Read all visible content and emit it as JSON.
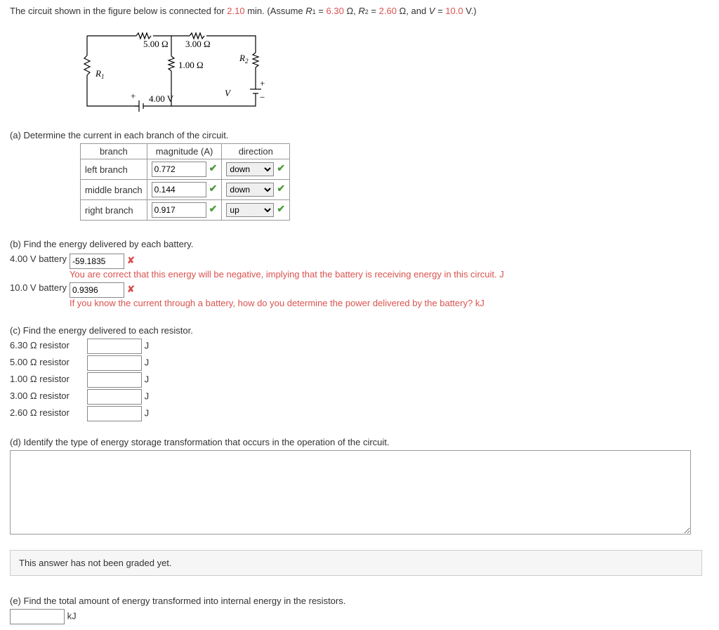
{
  "intro": {
    "prefix": "The circuit shown in the figure below is connected for ",
    "time": "2.10",
    "mid1": " min. (Assume ",
    "r1label": "R",
    "r1eq": " = ",
    "r1val": "6.30",
    "ohmsym": " Ω, ",
    "r2label": "R",
    "r2eq": " = ",
    "r2val": "2.60",
    "ohmsym2": " Ω, and ",
    "vlabel": "V",
    "veq": " = ",
    "vval": "10.0",
    "vunit": " V.)"
  },
  "circuit": {
    "r5": "5.00 Ω",
    "r3": "3.00 Ω",
    "r1": "1.00 Ω",
    "R1": "R",
    "R2": "R",
    "vsrc": "4.00 V",
    "V": "V"
  },
  "partA": {
    "prompt": "(a) Determine the current in each branch of the circuit.",
    "headers": {
      "branch": "branch",
      "mag": "magnitude (A)",
      "dir": "direction"
    },
    "rows": [
      {
        "branch": "left branch",
        "mag": "0.772",
        "dir": "down"
      },
      {
        "branch": "middle branch",
        "mag": "0.144",
        "dir": "down"
      },
      {
        "branch": "right branch",
        "mag": "0.917",
        "dir": "up"
      }
    ]
  },
  "partB": {
    "prompt": "(b) Find the energy delivered by each battery.",
    "rows": [
      {
        "label": "4.00 V battery",
        "val": "-59.1835",
        "unit": "J",
        "feedback": "You are correct that this energy will be negative, implying that the battery is receiving energy in this circuit. J"
      },
      {
        "label": "10.0 V battery",
        "val": "0.9396",
        "unit": "kJ",
        "feedback": "If you know the current through a battery, how do you determine the power delivered by the battery? kJ"
      }
    ]
  },
  "partC": {
    "prompt": "(c) Find the energy delivered to each resistor.",
    "rows": [
      {
        "label": "6.30 Ω resistor",
        "unit": "J"
      },
      {
        "label": "5.00 Ω resistor",
        "unit": "J"
      },
      {
        "label": "1.00 Ω resistor",
        "unit": "J"
      },
      {
        "label": "3.00 Ω resistor",
        "unit": "J"
      },
      {
        "label": "2.60 Ω resistor",
        "unit": "J"
      }
    ]
  },
  "partD": {
    "prompt": "(d) Identify the type of energy storage transformation that occurs in the operation of the circuit.",
    "gradeMsg": "This answer has not been graded yet."
  },
  "partE": {
    "prompt": "(e) Find the total amount of energy transformed into internal energy in the resistors.",
    "unit": "kJ"
  }
}
